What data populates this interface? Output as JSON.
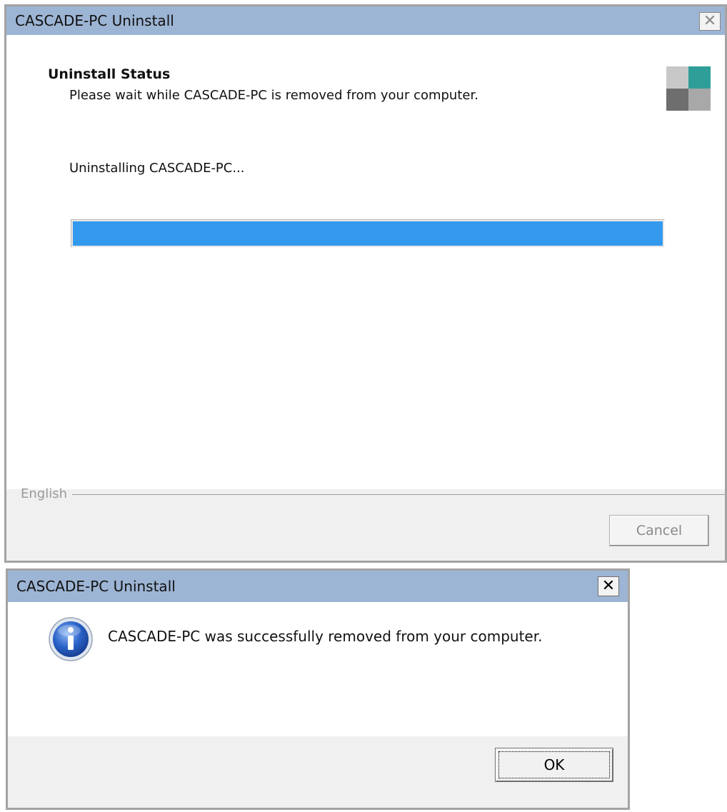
{
  "uninstall_window": {
    "title": "CASCADE-PC Uninstall",
    "close_glyph": "✕",
    "header_title": "Uninstall Status",
    "header_subtitle": "Please wait while CASCADE-PC is removed from your computer.",
    "status_text": "Uninstalling CASCADE-PC...",
    "progress_fraction": 1.0,
    "language_label": "English",
    "cancel_label": "Cancel",
    "logo_colors": [
      "#c8c8c8",
      "#2f9e98",
      "#6e6e6e",
      "#a8a8a8"
    ]
  },
  "message_box": {
    "title": "CASCADE-PC Uninstall",
    "close_glyph": "✕",
    "message": "CASCADE-PC was successfully removed from your computer.",
    "icon": "info-icon",
    "ok_label": "OK"
  }
}
